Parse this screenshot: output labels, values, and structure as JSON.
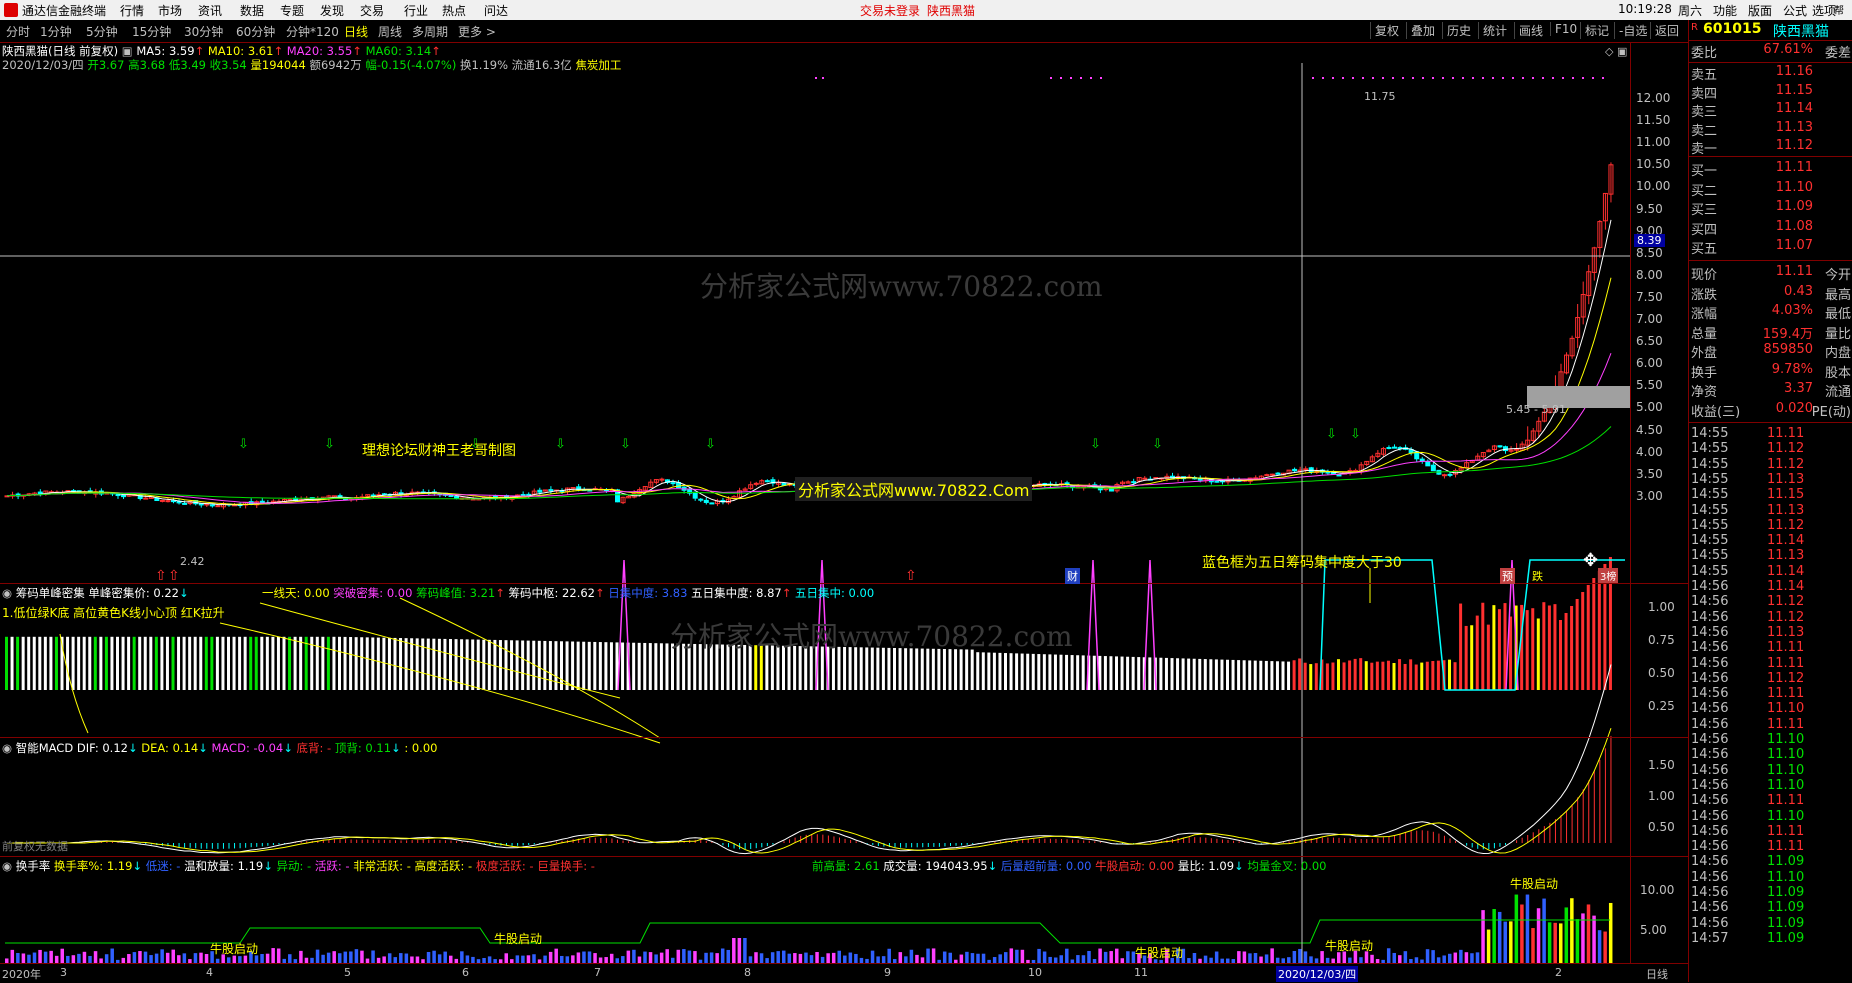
{
  "menubar": {
    "app_title": "通达信金融终端",
    "menus": [
      "行情",
      "市场",
      "资讯",
      "数据",
      "专题",
      "发现",
      "交易",
      "行业",
      "热点",
      "问达"
    ],
    "notice": "交易未登录",
    "stock_title": "陕西黑猫",
    "time": "10:19:28",
    "weekday": "周六",
    "right_menus": [
      "功能",
      "版面",
      "公式",
      "选项",
      "帮助"
    ]
  },
  "tabs": [
    "分时",
    "1分钟",
    "5分钟",
    "15分钟",
    "30分钟",
    "60分钟",
    "分钟*120",
    "日线",
    "周线",
    "多周期",
    "更多 >"
  ],
  "active_tab": "日线",
  "toolbar": [
    "复权",
    "叠加",
    "历史",
    "统计",
    "画线",
    "F10",
    "标记",
    "-自选",
    "返回"
  ],
  "main": {
    "title": "陕西黑猫(日线 前复权)",
    "ma5": "MA5: 3.59",
    "ma10": "MA10: 3.61",
    "ma20": "MA20: 3.55",
    "ma60": "MA60: 3.14",
    "date": "2020/12/03/四",
    "open": "开3.67",
    "high": "高3.68",
    "low": "低3.49",
    "close": "收3.54",
    "vol": "量194044",
    "amount": "额6942万",
    "change": "幅-0.15(-4.07%)",
    "turnover": "换1.19%",
    "float": "流通16.3亿",
    "industry": "焦炭加工",
    "y_labels": [
      "12.00",
      "11.50",
      "11.00",
      "10.50",
      "10.00",
      "9.50",
      "9.00",
      "8.50",
      "8.00",
      "7.50",
      "7.00",
      "6.50",
      "6.00",
      "5.50",
      "5.00",
      "4.50",
      "4.00",
      "3.50",
      "3.00"
    ],
    "cross_price": "8.39",
    "high_mark": "11.75",
    "low_mark": "2.42",
    "range_label": "5.45 - 5.91",
    "watermark": "分析家公式网www.70822.com",
    "watermark2": "分析家公式网www.70822.Com",
    "author_note": "理想论坛财神王老哥制图",
    "blue_box_note": "蓝色框为五日筹码集中度大于30",
    "cai": "财",
    "yu": "预",
    "die": "跌",
    "sheng": "3榜"
  },
  "panel2": {
    "title": "筹码单峰密集",
    "v1": "单峰密集价: 0.22",
    "v2": "一线天: 0.00",
    "v3": "突破密集: 0.00",
    "v4": "筹码峰值: 3.21",
    "v5": "筹码中枢: 22.62",
    "v6": "日集中度: 3.83",
    "v7": "五日集中度: 8.87",
    "v8": "五日集中: 0.00",
    "note": "1.低位绿K底 高位黄色K线小心顶 红K拉升",
    "y_labels": [
      "1.00",
      "0.75",
      "0.50",
      "0.25"
    ],
    "watermark": "分析家公式网www.70822.com"
  },
  "panel3": {
    "title": "智能MACD",
    "dif": "DIF: 0.12",
    "dea": "DEA: 0.14",
    "macd": "MACD: -0.04",
    "dibei": "底背: -",
    "dingbei": "顶背: 0.11",
    "extra": ": 0.00",
    "y_labels": [
      "1.50",
      "1.00",
      "0.50"
    ],
    "no_data": "前复权无数据"
  },
  "panel4": {
    "title": "换手率",
    "v1": "换手率%: 1.19",
    "v2": "低迷: -",
    "v3": "温和放量: 1.19",
    "v4": "异动: -",
    "v5": "活跃: -",
    "v6": "非常活跃: -",
    "v7": "高度活跃: -",
    "v8": "极度活跃: -",
    "v9": "巨量换手: -",
    "v10": "前高量: 2.61",
    "v11": "成交量: 194043.95",
    "v12": "后量超前量: 0.00",
    "v13": "牛股启动: 0.00",
    "v14": "量比: 1.09",
    "v15": "均量金叉: 0.00",
    "y_labels": [
      "10.00",
      "5.00"
    ],
    "niu_label": "牛股启动",
    "x_labels": [
      "2020年",
      "3",
      "4",
      "5",
      "6",
      "7",
      "8",
      "9",
      "10",
      "11",
      "2020/12/03/四",
      "2",
      "日线"
    ]
  },
  "quote": {
    "code": "601015",
    "name": "陕西黑猫",
    "weibi_label": "委比",
    "weibi": "67.61%",
    "weicha_label": "委差",
    "asks": [
      {
        "label": "卖五",
        "price": "11.16"
      },
      {
        "label": "卖四",
        "price": "11.15"
      },
      {
        "label": "卖三",
        "price": "11.14"
      },
      {
        "label": "卖二",
        "price": "11.13"
      },
      {
        "label": "卖一",
        "price": "11.12"
      }
    ],
    "bids": [
      {
        "label": "买一",
        "price": "11.11"
      },
      {
        "label": "买二",
        "price": "11.10"
      },
      {
        "label": "买三",
        "price": "11.09"
      },
      {
        "label": "买四",
        "price": "11.08"
      },
      {
        "label": "买五",
        "price": "11.07"
      }
    ],
    "stats": [
      {
        "l": "现价",
        "v": "11.11",
        "r": "今开"
      },
      {
        "l": "涨跌",
        "v": "0.43",
        "r": "最高"
      },
      {
        "l": "涨幅",
        "v": "4.03%",
        "r": "最低"
      },
      {
        "l": "总量",
        "v": "159.4万",
        "r": "量比"
      },
      {
        "l": "外盘",
        "v": "859850",
        "r": "内盘"
      },
      {
        "l": "换手",
        "v": "9.78%",
        "r": "股本"
      },
      {
        "l": "净资",
        "v": "3.37",
        "r": "流通"
      },
      {
        "l": "收益(三)",
        "v": "0.020",
        "r": "PE(动)"
      }
    ],
    "ticks": [
      {
        "t": "14:55",
        "p": "11.11",
        "c": "red"
      },
      {
        "t": "14:55",
        "p": "11.12",
        "c": "red"
      },
      {
        "t": "14:55",
        "p": "11.12",
        "c": "red"
      },
      {
        "t": "14:55",
        "p": "11.13",
        "c": "red"
      },
      {
        "t": "14:55",
        "p": "11.15",
        "c": "red"
      },
      {
        "t": "14:55",
        "p": "11.13",
        "c": "red"
      },
      {
        "t": "14:55",
        "p": "11.12",
        "c": "red"
      },
      {
        "t": "14:55",
        "p": "11.14",
        "c": "red"
      },
      {
        "t": "14:55",
        "p": "11.13",
        "c": "red"
      },
      {
        "t": "14:55",
        "p": "11.14",
        "c": "red"
      },
      {
        "t": "14:56",
        "p": "11.14",
        "c": "red"
      },
      {
        "t": "14:56",
        "p": "11.12",
        "c": "red"
      },
      {
        "t": "14:56",
        "p": "11.12",
        "c": "red"
      },
      {
        "t": "14:56",
        "p": "11.13",
        "c": "red"
      },
      {
        "t": "14:56",
        "p": "11.11",
        "c": "red"
      },
      {
        "t": "14:56",
        "p": "11.11",
        "c": "red"
      },
      {
        "t": "14:56",
        "p": "11.12",
        "c": "red"
      },
      {
        "t": "14:56",
        "p": "11.11",
        "c": "red"
      },
      {
        "t": "14:56",
        "p": "11.10",
        "c": "red"
      },
      {
        "t": "14:56",
        "p": "11.11",
        "c": "red"
      },
      {
        "t": "14:56",
        "p": "11.10",
        "c": "grn"
      },
      {
        "t": "14:56",
        "p": "11.10",
        "c": "grn"
      },
      {
        "t": "14:56",
        "p": "11.10",
        "c": "grn"
      },
      {
        "t": "14:56",
        "p": "11.10",
        "c": "grn"
      },
      {
        "t": "14:56",
        "p": "11.11",
        "c": "red"
      },
      {
        "t": "14:56",
        "p": "11.10",
        "c": "grn"
      },
      {
        "t": "14:56",
        "p": "11.11",
        "c": "red"
      },
      {
        "t": "14:56",
        "p": "11.11",
        "c": "red"
      },
      {
        "t": "14:56",
        "p": "11.09",
        "c": "grn"
      },
      {
        "t": "14:56",
        "p": "11.10",
        "c": "grn"
      },
      {
        "t": "14:56",
        "p": "11.09",
        "c": "grn"
      },
      {
        "t": "14:56",
        "p": "11.09",
        "c": "grn"
      },
      {
        "t": "14:56",
        "p": "11.09",
        "c": "grn"
      },
      {
        "t": "14:57",
        "p": "11.09",
        "c": "grn"
      }
    ],
    "tick_sides": [
      "1",
      "1",
      "2"
    ]
  },
  "colors": {
    "up": "#ff3030",
    "down": "#00ffff",
    "ma5": "#ffffff",
    "ma10": "#ffff00",
    "ma20": "#ff40ff",
    "ma60": "#00e000",
    "border": "#800000"
  }
}
